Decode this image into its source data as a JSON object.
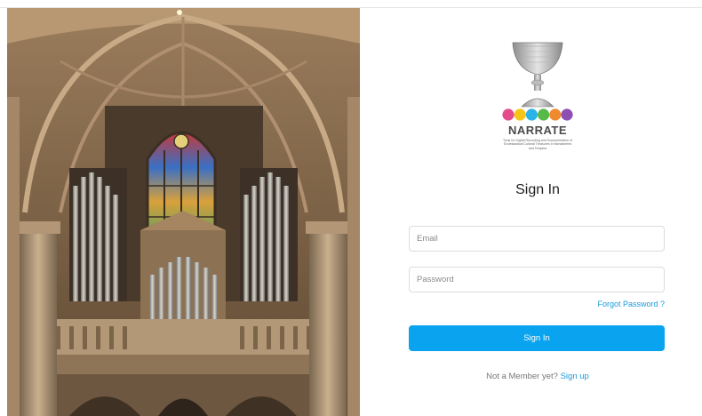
{
  "hero": {
    "description_icon": "cathedral-organ-photo"
  },
  "brand": {
    "name": "NARRATE",
    "tagline": "Tools for Digital Recording and Documentation of Ecclesiastical Cultural Treasures in Monasteries and Temples",
    "dot_colors": [
      "#e44b8d",
      "#f5c518",
      "#2ab3e6",
      "#57b947",
      "#f1892d",
      "#8e4fb2"
    ]
  },
  "form": {
    "title": "Sign In",
    "email_placeholder": "Email",
    "password_placeholder": "Password",
    "forgot_label": "Forgot Password ?",
    "submit_label": "Sign In",
    "member_text": "Not a Member yet?",
    "signup_label": "Sign up"
  },
  "colors": {
    "accent": "#0aa3ef",
    "link": "#1a9bdc"
  }
}
